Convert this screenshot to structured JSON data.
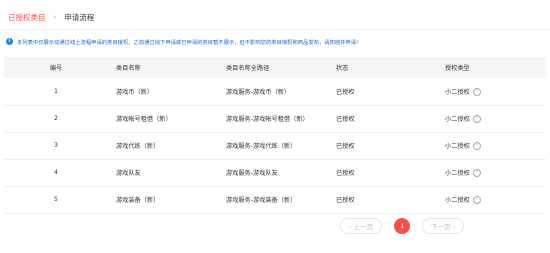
{
  "breadcrumb": {
    "parent": "已授权类目",
    "separator": "›",
    "current": "申请流程"
  },
  "notice": {
    "icon": "info-icon",
    "text": "本列表中仅展示动通过线上流程申请的类目授权，之前通过线下申请或已申请的类目暂不展示，但不影响您的类目授权和商品发布，请知晓并申请!"
  },
  "table": {
    "headers": [
      "编号",
      "类目名称",
      "类目名称全路径",
      "状态",
      "授权类型"
    ],
    "rows": [
      {
        "no": "1",
        "name": "游戏币（新）",
        "path": "游戏服务-游戏币（新）",
        "status": "已授权",
        "type": "小二授权"
      },
      {
        "no": "2",
        "name": "游戏帐号租借（新）",
        "path": "游戏服务-游戏帐号租借（新）",
        "status": "已授权",
        "type": "小二授权"
      },
      {
        "no": "3",
        "name": "游戏代练（新）",
        "path": "游戏服务-游戏代练（新）",
        "status": "已授权",
        "type": "小二授权"
      },
      {
        "no": "4",
        "name": "游戏队友",
        "path": "游戏服务-游戏队友",
        "status": "已授权",
        "type": "小二授权"
      },
      {
        "no": "5",
        "name": "游戏装备（新）",
        "path": "游戏服务-游戏装备（新）",
        "status": "已授权",
        "type": "小二授权"
      }
    ],
    "help_icon": "question-icon"
  },
  "pagination": {
    "prev": "‹ 上一页",
    "current_page": "1",
    "next": "下一页 ›"
  },
  "colors": {
    "accent": "#ff4b4b",
    "notice_text": "#1e66c9",
    "header_bg": "#f5f6f7"
  }
}
